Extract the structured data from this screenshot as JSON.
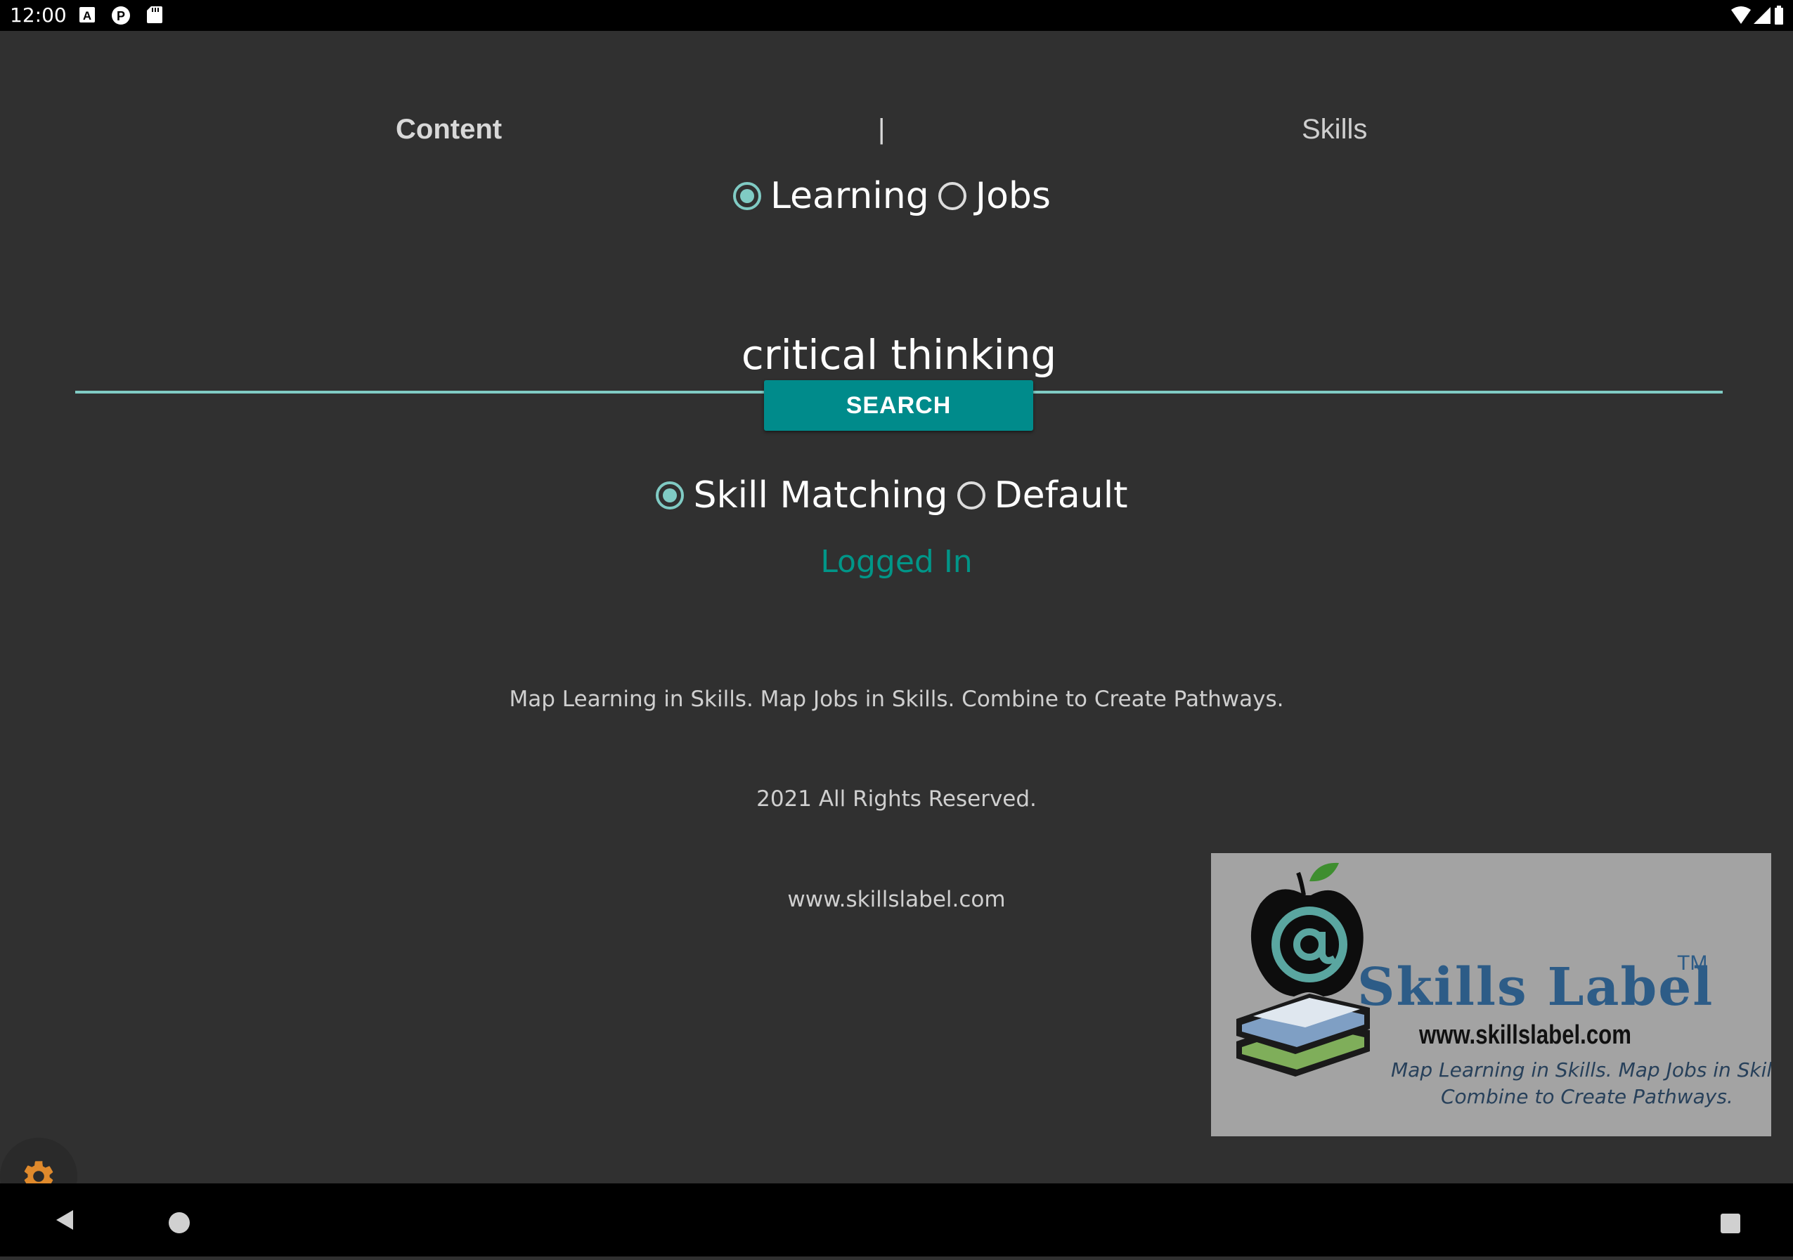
{
  "status_bar": {
    "time": "12:00",
    "icons": [
      "a-notification-icon",
      "p-notification-icon",
      "sd-card-icon"
    ],
    "right_icons": [
      "wifi-icon",
      "signal-icon",
      "battery-icon"
    ]
  },
  "tabs": {
    "content": "Content",
    "separator": "|",
    "skills": "Skills",
    "active": "content"
  },
  "type_options": {
    "learning": "Learning",
    "jobs": "Jobs",
    "selected": "learning"
  },
  "search": {
    "value": "critical thinking",
    "button_label": "SEARCH"
  },
  "mode_options": {
    "skill_matching": "Skill Matching",
    "default": "Default",
    "selected": "skill_matching"
  },
  "status": {
    "logged_in": "Logged In"
  },
  "footer": {
    "tagline": "Map Learning in Skills. Map Jobs in Skills. Combine to Create Pathways.",
    "rights": "2021 All Rights Reserved.",
    "website": "www.skillslabel.com"
  },
  "logo": {
    "title": "Skills Label",
    "tm": "TM",
    "url": "www.skillslabel.com",
    "tagline_line1": "Map Learning in Skills. Map Jobs in Skills.",
    "tagline_line2": "Combine to Create Pathways."
  },
  "colors": {
    "background": "#303030",
    "accent": "#80cbc4",
    "button": "#008b8b",
    "logged_in": "#009688",
    "settings_icon": "#e08a2c"
  }
}
